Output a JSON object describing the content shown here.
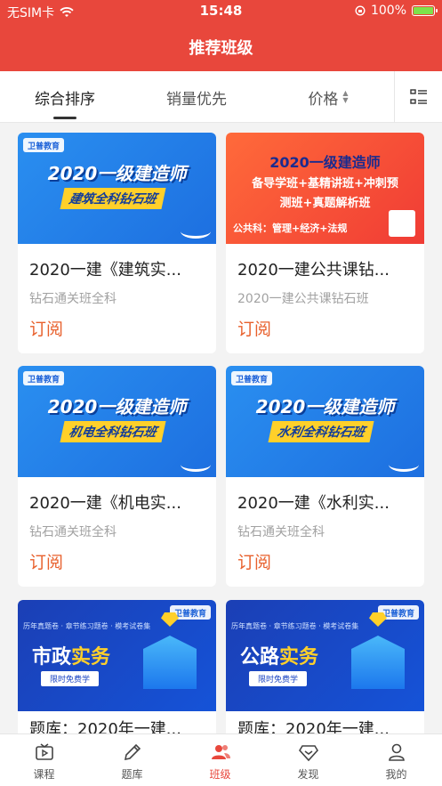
{
  "status_bar": {
    "carrier": "无SIM卡",
    "time": "15:48",
    "battery_text": "100%"
  },
  "nav": {
    "title": "推荐班级"
  },
  "tabs": [
    {
      "label": "综合排序",
      "active": true
    },
    {
      "label": "销量优先",
      "active": false
    },
    {
      "label": "价格",
      "active": false,
      "sort_arrows": true
    }
  ],
  "view_toggle_icon": "list-grid-icon",
  "courses": [
    {
      "title": "2020一建《建筑实...",
      "subtitle": "钻石通关班全科",
      "action": "订阅",
      "banner": {
        "style": "blue",
        "logo": "卫普教育",
        "headline": "2020一级建造师",
        "ribbon": "建筑全科钻石班"
      }
    },
    {
      "title": "2020一建公共课钻...",
      "subtitle": "2020一建公共课钻石班",
      "action": "订阅",
      "banner": {
        "style": "red",
        "line1": "2020一级建造师",
        "line2": "备导学班+基精讲班+冲刺预",
        "line3": "测班+真题解析班",
        "footer": "公共科：管理+经济+法规"
      }
    },
    {
      "title": "2020一建《机电实...",
      "subtitle": "钻石通关班全科",
      "action": "订阅",
      "banner": {
        "style": "blue",
        "logo": "卫普教育",
        "headline": "2020一级建造师",
        "ribbon": "机电全科钻石班"
      }
    },
    {
      "title": "2020一建《水利实...",
      "subtitle": "钻石通关班全科",
      "action": "订阅",
      "banner": {
        "style": "blue",
        "logo": "卫普教育",
        "headline": "2020一级建造师",
        "ribbon": "水利全科钻石班"
      }
    },
    {
      "title": "题库：2020年一建...",
      "subtitle": "",
      "action": "",
      "banner": {
        "style": "navy",
        "logo": "卫普教育",
        "top": "历年真题卷 · 章节练习题卷 · 模考试卷集",
        "title_main": "市政",
        "title_hl": "实务",
        "button": "限时免费学"
      }
    },
    {
      "title": "题库：2020年一建...",
      "subtitle": "",
      "action": "",
      "banner": {
        "style": "navy",
        "logo": "卫普教育",
        "top": "历年真题卷 · 章节练习题卷 · 模考试卷集",
        "title_main": "公路",
        "title_hl": "实务",
        "button": "限时免费学"
      }
    }
  ],
  "tab_bar": [
    {
      "label": "课程",
      "icon": "tv-icon",
      "active": false
    },
    {
      "label": "题库",
      "icon": "pencil-icon",
      "active": false
    },
    {
      "label": "班级",
      "icon": "users-icon",
      "active": true
    },
    {
      "label": "发现",
      "icon": "diamond-icon",
      "active": false
    },
    {
      "label": "我的",
      "icon": "person-icon",
      "active": false
    }
  ],
  "colors": {
    "brand_red": "#e8473c",
    "accent_orange": "#e8602c"
  }
}
